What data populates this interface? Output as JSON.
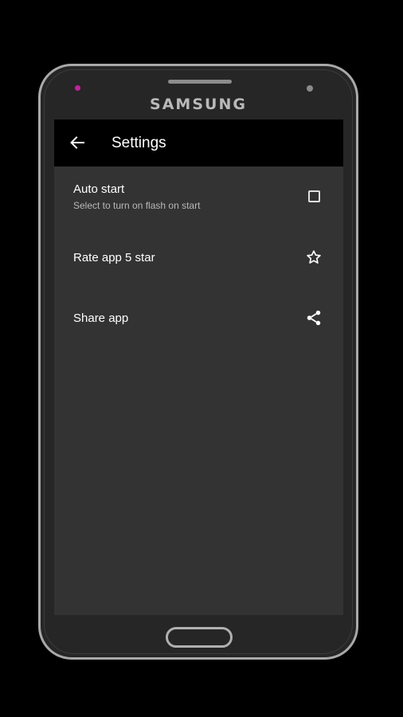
{
  "device": {
    "brand": "SAMSUNG"
  },
  "appbar": {
    "title": "Settings",
    "back_icon": "arrow-left-icon"
  },
  "settings": {
    "auto_start": {
      "title": "Auto start",
      "subtitle": "Select to turn on flash on start",
      "checked": false,
      "icon": "checkbox-icon"
    },
    "rate": {
      "title": "Rate app 5 star",
      "icon": "star-outline-icon"
    },
    "share": {
      "title": "Share app",
      "icon": "share-icon"
    }
  },
  "colors": {
    "background": "#000000",
    "screen": "#333333",
    "appbar": "#000000",
    "text_primary": "#ffffff",
    "text_secondary": "#b8b8b8",
    "led": "#c0239a"
  }
}
